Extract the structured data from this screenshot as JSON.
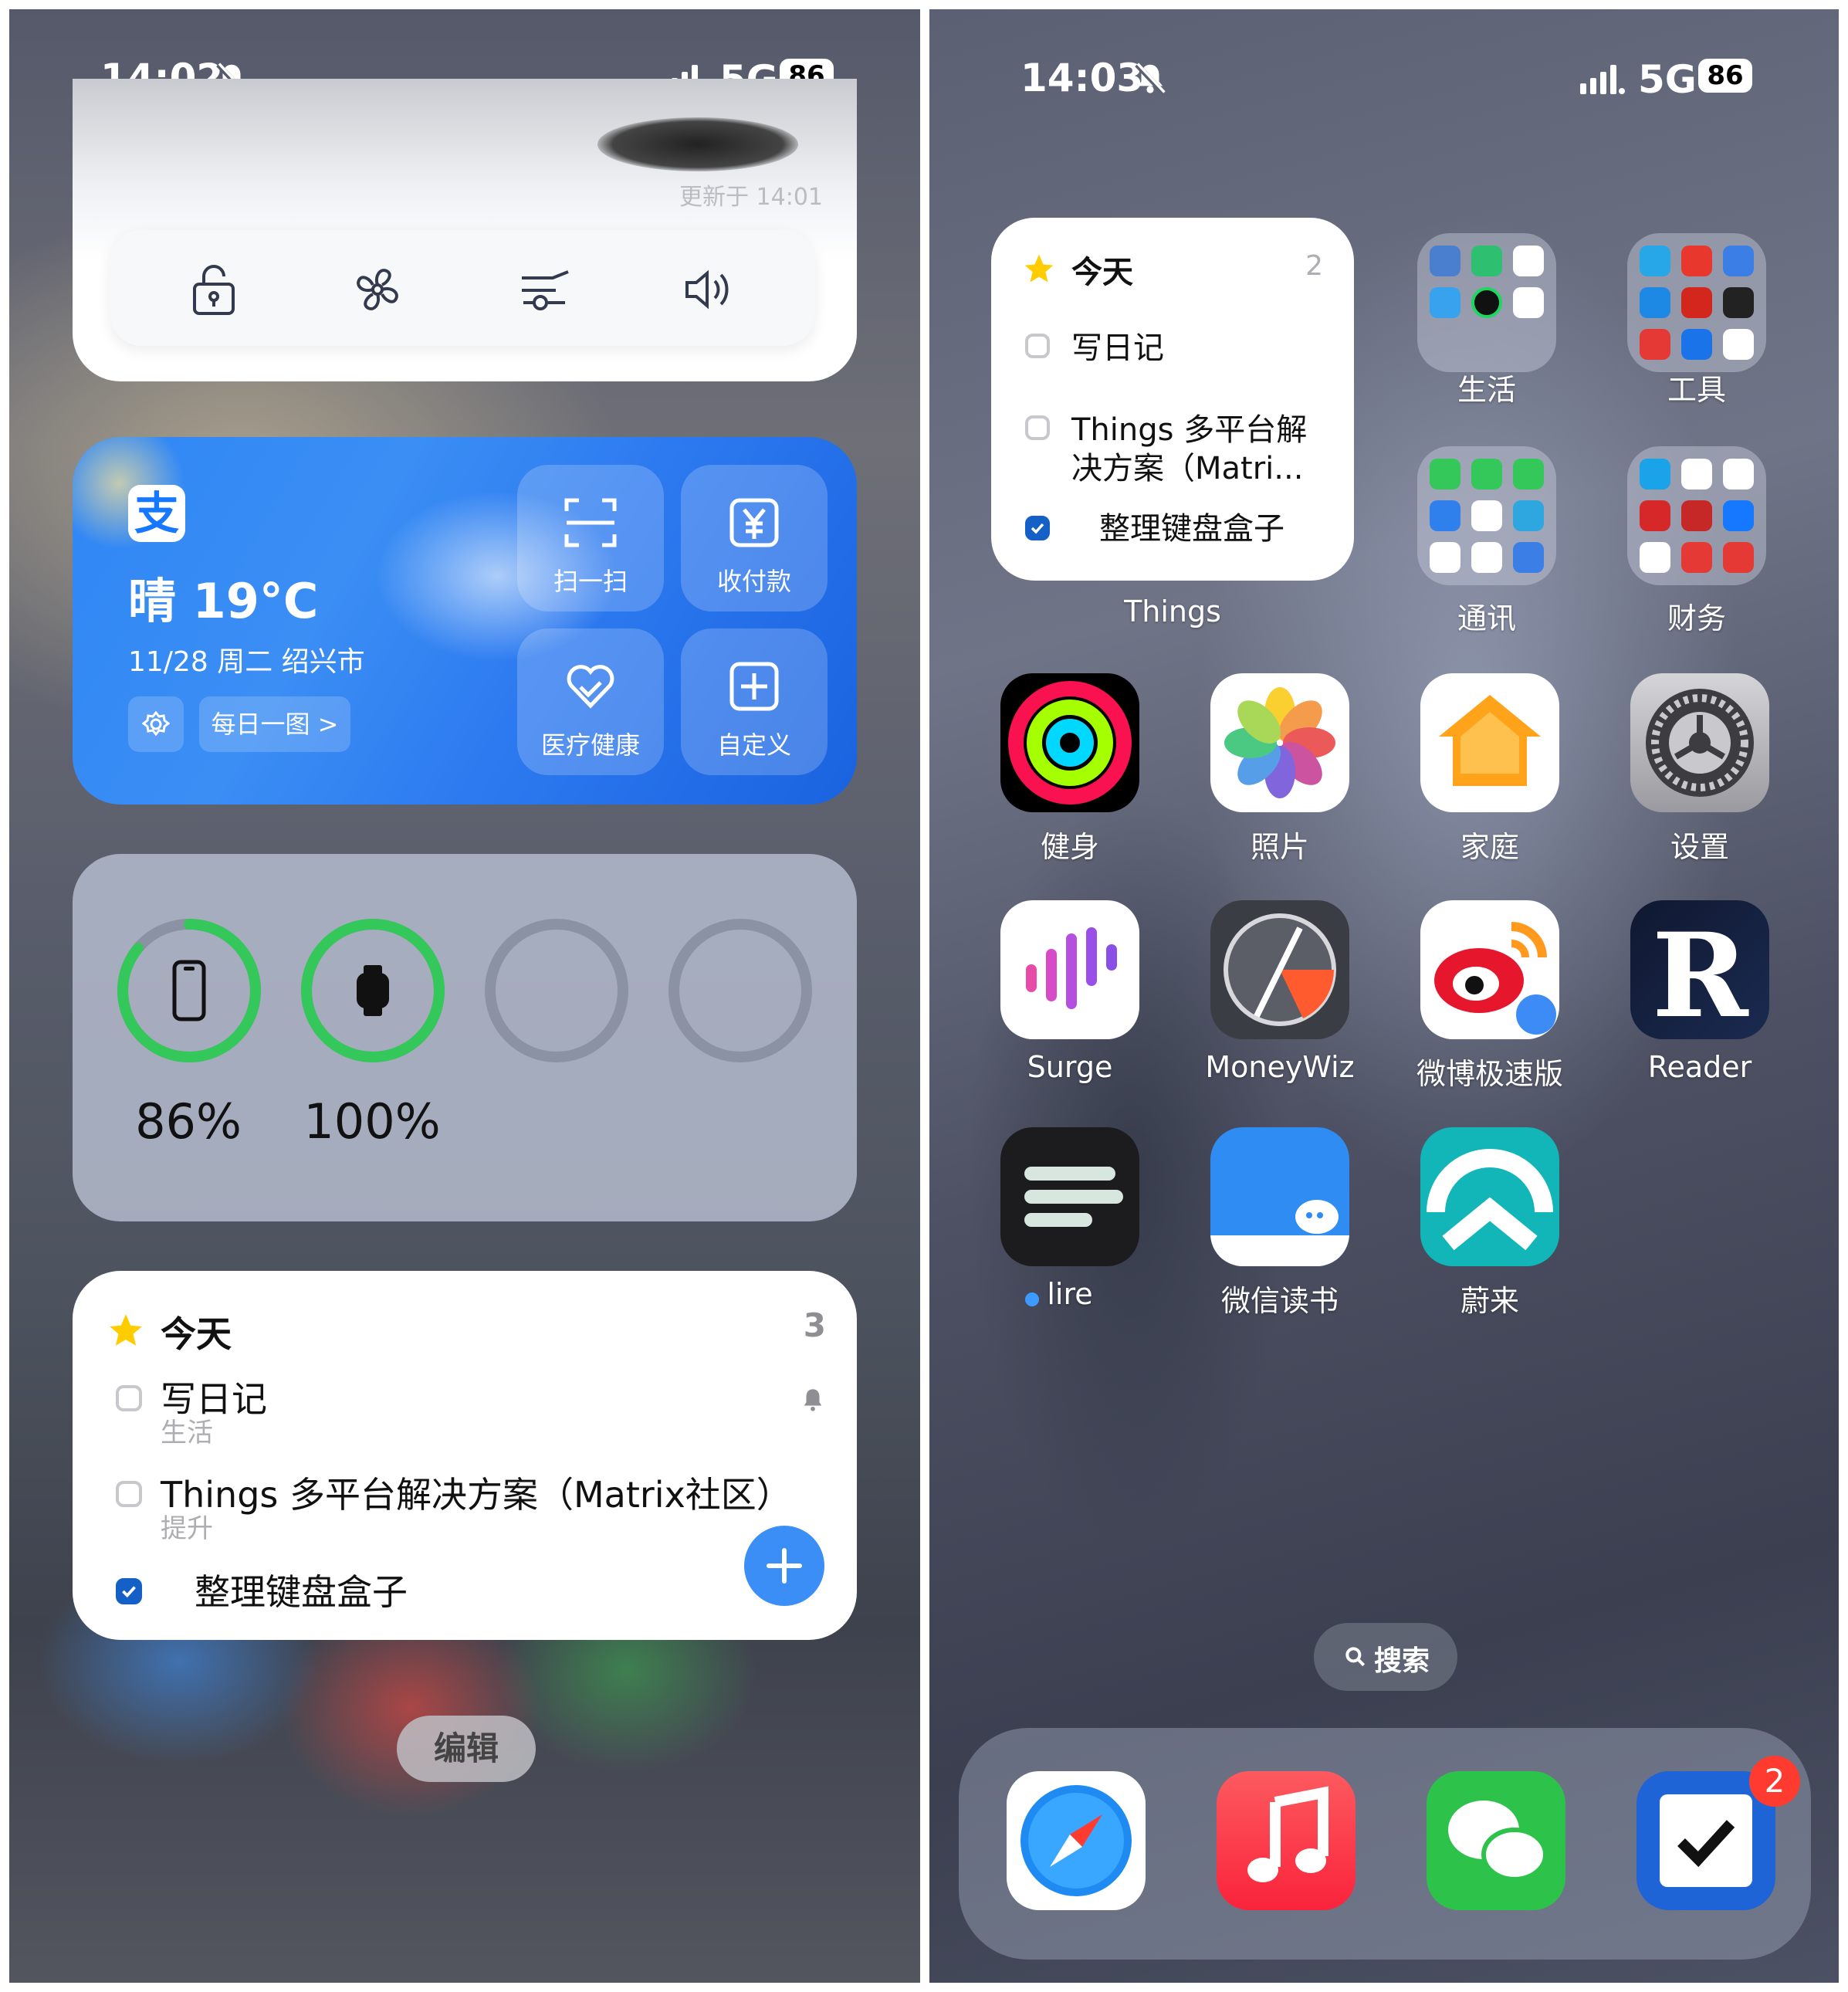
{
  "left": {
    "status": {
      "time": "14:02",
      "network": "5G",
      "battery": "86"
    },
    "car_widget": {
      "updated": "更新于 14:01",
      "controls": [
        "lock-icon",
        "fan-icon",
        "trunk-icon",
        "horn-icon"
      ]
    },
    "alipay": {
      "weather": "晴 19°C",
      "date_city": "11/28 周二 绍兴市",
      "daily_button": "每日一图 >",
      "actions": [
        {
          "label": "扫一扫",
          "icon": "scan-icon"
        },
        {
          "label": "收付款",
          "icon": "yuan-icon"
        },
        {
          "label": "医疗健康",
          "icon": "heart-icon"
        },
        {
          "label": "自定义",
          "icon": "plus-square-icon"
        }
      ]
    },
    "batteries": [
      {
        "device": "iphone",
        "percent": "86%",
        "level": 0.86
      },
      {
        "device": "watch",
        "percent": "100%",
        "level": 1.0
      }
    ],
    "things": {
      "title": "今天",
      "count": "3",
      "items": [
        {
          "text": "写日记",
          "sub": "生活",
          "checked": false
        },
        {
          "text": "Things 多平台解决方案（Matrix社区）",
          "sub": "提升",
          "checked": false
        },
        {
          "text": "整理键盘盒子",
          "sub": "",
          "checked": true
        }
      ]
    },
    "edit_button": "编辑"
  },
  "right": {
    "status": {
      "time": "14:03",
      "network": "5G",
      "battery": "86"
    },
    "things_widget": {
      "title": "今天",
      "count": "2",
      "items": [
        {
          "text": "写日记",
          "checked": false
        },
        {
          "text": "Things 多平台解",
          "text2": "决方案（Matri...",
          "checked": false
        },
        {
          "text": "整理键盘盒子",
          "checked": true
        }
      ],
      "label": "Things"
    },
    "folders": [
      {
        "label": "生活"
      },
      {
        "label": "工具"
      },
      {
        "label": "通讯"
      },
      {
        "label": "财务"
      }
    ],
    "apps": [
      {
        "label": "健身"
      },
      {
        "label": "照片"
      },
      {
        "label": "家庭"
      },
      {
        "label": "设置"
      },
      {
        "label": "Surge"
      },
      {
        "label": "MoneyWiz"
      },
      {
        "label": "微博极速版"
      },
      {
        "label": "Reader"
      },
      {
        "label": "lire"
      },
      {
        "label": "微信读书"
      },
      {
        "label": "蔚来"
      }
    ],
    "search": "搜索",
    "dock_badge": "2"
  }
}
